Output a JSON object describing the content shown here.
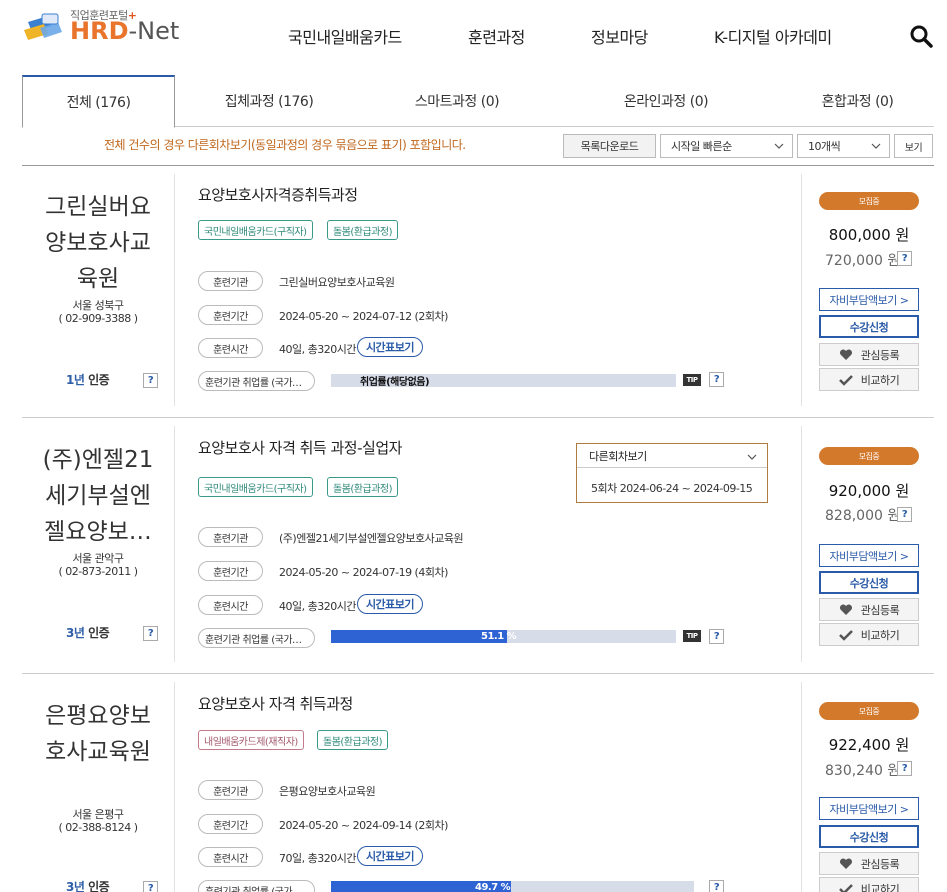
{
  "header": {
    "logo_sub": "직업훈련포털",
    "logo_plus": "+",
    "logo_hrd": "HRD",
    "logo_dash": "-",
    "logo_net": "Net",
    "nav": [
      "국민내일배움카드",
      "훈련과정",
      "정보마당",
      "K-디지털 아카데미"
    ]
  },
  "tabs": [
    "전체 (176)",
    "집체과정 (176)",
    "스마트과정 (0)",
    "온라인과정 (0)",
    "혼합과정 (0)"
  ],
  "toolbar": {
    "notice": "전체 건수의 경우 다른회차보기(동일과정의 경우 묶음으로 표기) 포함입니다.",
    "download": "목록다운로드",
    "sort": "시작일 빠른순",
    "per_page": "10개씩",
    "view": "보기"
  },
  "common": {
    "q": "?",
    "tip": "TIP",
    "cert_suffix": "인증",
    "label_org": "훈련기관",
    "label_period": "훈련기간",
    "label_time": "훈련시간",
    "label_employ": "훈련기관 취업률 (국가…",
    "timetable": "시간표보기",
    "status": "모집중",
    "self_pay": "자비부담액보기 >",
    "apply": "수강신청",
    "interest": "관심등록",
    "compare": "비교하기"
  },
  "courses": [
    {
      "org_lines": [
        "그린실버요",
        "양보호사교",
        "육원"
      ],
      "location": "서울 성북구",
      "phone": "( 02-909-3388 )",
      "cert_year": "1년",
      "title": "요양보호사자격증취득과정",
      "tags": [
        "국민내일배움카드(구직자)",
        "돌봄(환급과정)"
      ],
      "institution": "그린실버요양보호사교육원",
      "period": "2024-05-20 ~ 2024-07-12 (2회차)",
      "hours": "40일, 총320시간",
      "employment_rate_pct": 0,
      "employment_label": "취업률(해당없음)",
      "price": "800,000 원",
      "self_price": "720,000 원"
    },
    {
      "org_lines": [
        "(주)엔젤21",
        "세기부설엔",
        "젤요양보…"
      ],
      "location": "서울 관악구",
      "phone": "( 02-873-2011 )",
      "cert_year": "3년",
      "title": "요양보호사 자격 취득 과정-실업자",
      "tags": [
        "국민내일배움카드(구직자)",
        "돌봄(환급과정)"
      ],
      "institution": "(주)엔젤21세기부설엔젤요양보호사교육원",
      "period": "2024-05-20 ~ 2024-07-19 (4회차)",
      "hours": "40일, 총320시간",
      "employment_rate_pct": 51.1,
      "employment_label": "51.1 %",
      "price": "920,000 원",
      "self_price": "828,000 원"
    },
    {
      "org_lines": [
        "은평요양보",
        "호사교육원"
      ],
      "location": "서울 은평구",
      "phone": "( 02-388-8124 )",
      "cert_year": "3년",
      "title": "요양보호사 자격 취득과정",
      "tags": [
        "내일배움카드제(재직자)",
        "돌봄(환급과정)"
      ],
      "institution": "은평요양보호사교육원",
      "period": "2024-05-20 ~ 2024-09-14 (2회차)",
      "hours": "70일, 총320시간",
      "employment_rate_pct": 49.7,
      "employment_label": "49.7 %",
      "price": "922,400 원",
      "self_price": "830,240 원"
    }
  ],
  "session_dropdown": {
    "label": "다른회차보기",
    "item": "5회차 2024-06-24 ~ 2024-09-15"
  },
  "colors": {
    "brand_blue": "#2a5ba8",
    "brand_orange": "#d3792c",
    "bar_fill": "#2e63d4"
  }
}
